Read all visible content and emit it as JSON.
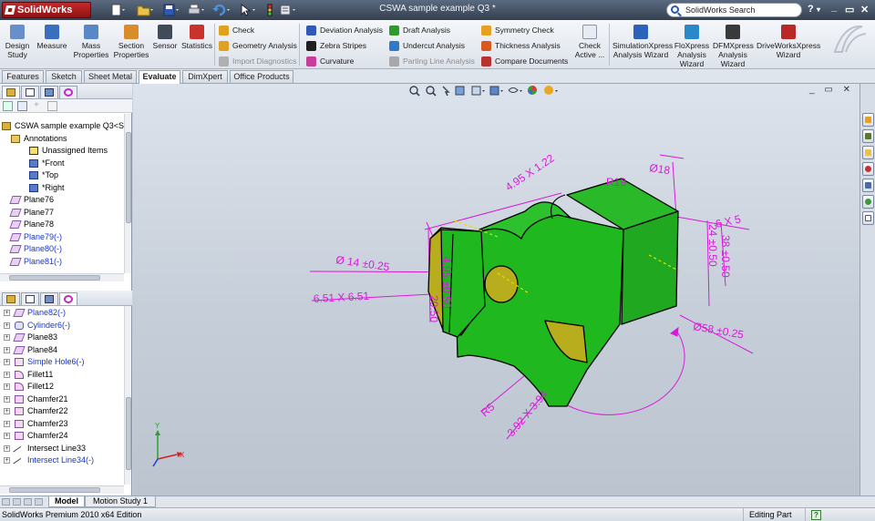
{
  "app": {
    "logo": "SolidWorks",
    "document_title": "CSWA sample example Q3 *",
    "search_placeholder": "SolidWorks Search",
    "help": "?"
  },
  "quick_access": [
    {
      "name": "new",
      "icon": "new-document-icon"
    },
    {
      "name": "open",
      "icon": "open-folder-icon"
    },
    {
      "name": "save",
      "icon": "save-icon"
    },
    {
      "name": "print",
      "icon": "print-icon"
    },
    {
      "name": "undo",
      "icon": "undo-icon"
    },
    {
      "name": "select",
      "icon": "select-arrow-icon"
    },
    {
      "name": "rebuild",
      "icon": "traffic-light-icon"
    },
    {
      "name": "options",
      "icon": "options-icon"
    }
  ],
  "command_manager": {
    "big_tools": [
      {
        "label1": "Design",
        "label2": "Study",
        "color": "#6a8ec8"
      },
      {
        "label1": "Measure",
        "label2": "",
        "color": "#3a6fc0"
      },
      {
        "label1": "Mass",
        "label2": "Properties",
        "color": "#5a88c6"
      },
      {
        "label1": "Section",
        "label2": "Properties",
        "color": "#d88c2a"
      },
      {
        "label1": "Sensor",
        "label2": "",
        "color": "#404a58"
      },
      {
        "label1": "Statistics",
        "label2": "",
        "color": "#c8342c"
      }
    ],
    "check_group": [
      {
        "label": "Check",
        "enabled": true,
        "color": "#e0a020"
      },
      {
        "label": "Geometry Analysis",
        "enabled": true,
        "color": "#e0a020"
      },
      {
        "label": "Import Diagnostics",
        "enabled": false,
        "color": "#b0b0b0"
      }
    ],
    "analysis_group_a": [
      {
        "label": "Deviation Analysis",
        "enabled": true,
        "color": "#3258b8"
      },
      {
        "label": "Zebra Stripes",
        "enabled": true,
        "color": "#202020"
      },
      {
        "label": "Curvature",
        "enabled": true,
        "color": "#c83c9c"
      }
    ],
    "analysis_group_b": [
      {
        "label": "Draft Analysis",
        "enabled": true,
        "color": "#2e9a2e"
      },
      {
        "label": "Undercut Analysis",
        "enabled": true,
        "color": "#2e7ac8"
      },
      {
        "label": "Parting Line Analysis",
        "enabled": false,
        "color": "#a8a8a8"
      }
    ],
    "analysis_group_c": [
      {
        "label": "Symmetry Check",
        "enabled": true,
        "color": "#e8a020"
      },
      {
        "label": "Thickness Analysis",
        "enabled": true,
        "color": "#d85a20"
      },
      {
        "label": "Compare Documents",
        "enabled": true,
        "color": "#b83232"
      }
    ],
    "check_active": {
      "label1": "Check",
      "label2": "Active ..."
    },
    "xpress": [
      {
        "label1": "SimulationXpress",
        "label2": "Analysis Wizard",
        "color": "#2c62b8"
      },
      {
        "label1": "FloXpress",
        "label2": "Analysis",
        "label3": "Wizard",
        "color": "#2a88c8"
      },
      {
        "label1": "DFMXpress",
        "label2": "Analysis",
        "label3": "Wizard",
        "color": "#3a3a3a"
      },
      {
        "label1": "DriveWorksXpress",
        "label2": "Wizard",
        "color": "#b82828"
      }
    ]
  },
  "tabs": [
    {
      "label": "Features",
      "active": false
    },
    {
      "label": "Sketch",
      "active": false
    },
    {
      "label": "Sheet Metal",
      "active": false
    },
    {
      "label": "Evaluate",
      "active": true
    },
    {
      "label": "DimXpert",
      "active": false
    },
    {
      "label": "Office Products",
      "active": false
    }
  ],
  "feature_tree_top": [
    {
      "label": "CSWA sample example Q3<S",
      "indent": 0,
      "blue": false,
      "icon": "part-icon"
    },
    {
      "label": "Annotations",
      "indent": 1,
      "blue": false,
      "icon": "annotations-icon"
    },
    {
      "label": "Unassigned Items",
      "indent": 3,
      "blue": false,
      "icon": "unassigned-items-icon"
    },
    {
      "label": "*Front",
      "indent": 3,
      "blue": false,
      "icon": "view-icon"
    },
    {
      "label": "*Top",
      "indent": 3,
      "blue": false,
      "icon": "view-icon"
    },
    {
      "label": "*Right",
      "indent": 3,
      "blue": false,
      "icon": "view-icon"
    },
    {
      "label": "Plane76",
      "indent": 1,
      "blue": false,
      "icon": "plane-icon"
    },
    {
      "label": "Plane77",
      "indent": 1,
      "blue": false,
      "icon": "plane-icon"
    },
    {
      "label": "Plane78",
      "indent": 1,
      "blue": false,
      "icon": "plane-icon"
    },
    {
      "label": "Plane79(-)",
      "indent": 1,
      "blue": true,
      "icon": "plane-icon"
    },
    {
      "label": "Plane80(-)",
      "indent": 1,
      "blue": true,
      "icon": "plane-icon"
    },
    {
      "label": "Plane81(-)",
      "indent": 1,
      "blue": true,
      "icon": "plane-icon"
    }
  ],
  "feature_tree_bottom": [
    {
      "label": "Plane82(-)",
      "blue": true,
      "icon": "plane-icon"
    },
    {
      "label": "Cylinder6(-)",
      "blue": true,
      "icon": "cylinder-icon"
    },
    {
      "label": "Plane83",
      "blue": false,
      "icon": "plane-icon"
    },
    {
      "label": "Plane84",
      "blue": false,
      "icon": "plane-icon"
    },
    {
      "label": "Simple Hole6(-)",
      "blue": true,
      "icon": "hole-icon"
    },
    {
      "label": "Fillet11",
      "blue": false,
      "icon": "fillet-icon"
    },
    {
      "label": "Fillet12",
      "blue": false,
      "icon": "fillet-icon"
    },
    {
      "label": "Chamfer21",
      "blue": false,
      "icon": "chamfer-icon"
    },
    {
      "label": "Chamfer22",
      "blue": false,
      "icon": "chamfer-icon"
    },
    {
      "label": "Chamfer23",
      "blue": false,
      "icon": "chamfer-icon"
    },
    {
      "label": "Chamfer24",
      "blue": false,
      "icon": "chamfer-icon"
    },
    {
      "label": "Intersect Line33",
      "blue": false,
      "icon": "intersect-line-icon"
    },
    {
      "label": "Intersect Line34(-)",
      "blue": true,
      "icon": "intersect-line-icon"
    }
  ],
  "dimensions": {
    "d1": "4.95 X 1.22",
    "d2": "R19",
    "d3": "Ø18",
    "d4": "6 X 5",
    "d5": "24 ±0.50",
    "d6": "38 ±0.50",
    "d7": "Ø 14 ±0.25",
    "d8": "4.95 ±0.50",
    "d9": "20.50",
    "d10": "6.51 X 6.51",
    "d11": "Ø58 ±0.25",
    "d12": "R5",
    "d13": "3.92 X 3.94"
  },
  "triad": {
    "x": "X",
    "y": "Y"
  },
  "bottom_tabs": [
    {
      "label": "Model",
      "active": true
    },
    {
      "label": "Motion Study 1",
      "active": false
    }
  ],
  "status": {
    "edition": "SolidWorks Premium 2010 x64 Edition",
    "mode": "Editing Part",
    "help_icon": "?"
  },
  "colors": {
    "part_green": "#1fb81f",
    "part_yellow": "#b8ad1c",
    "dimension": "#d81ad8",
    "accent_red": "#c8282a"
  }
}
